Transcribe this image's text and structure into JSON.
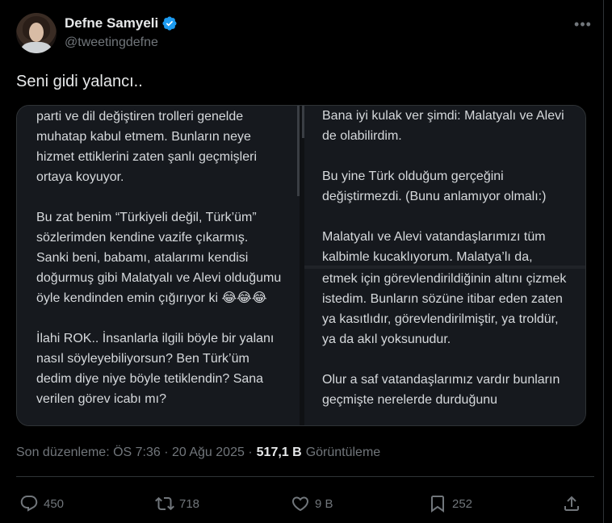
{
  "author": {
    "display_name": "Defne Samyeli",
    "handle": "@tweetingdefne"
  },
  "tweet": {
    "text": "Seni gidi yalancı..",
    "media": {
      "left_text": "parti ve dil değiştiren trolleri genelde muhatap kabul etmem. Bunların neye hizmet ettiklerini zaten şanlı geçmişleri ortaya koyuyor.\n\nBu zat benim “Türkiyeli değil, Türk’üm” sözlerimden kendine vazife çıkarmış. Sanki beni, babamı, atalarımı kendisi doğurmuş gibi  Malatyalı ve Alevi olduğumu öyle kendinden emin çığırıyor ki 😂😂😂\n\n İlahi ROK.. İnsanlarla ilgili böyle bir yalanı nasıl söyleyebiliyorsun? Ben Türk’üm dedim diye niye böyle tetiklendin? Sana verilen görev icabı mı?",
      "right_top_text": "Bana iyi kulak ver şimdi: Malatyalı ve Alevi de olabilirdim.\n\nBu yine Türk olduğum gerçeğini değiştirmezdi. (Bunu anlamıyor olmalı:)\n\nMalatyalı ve Alevi vatandaşlarımızı tüm kalbimle kucaklıyorum. Malatya’lı da,",
      "right_bottom_text": "etmek için görevlendirildiğinin altını çizmek istedim. Bunların sözüne itibar eden zaten ya kasıtlıdır, görevlendirilmiştir, ya troldür, ya da akıl yoksunudur.\n\nOlur a saf vatandaşlarımız vardır bunların geçmişte nerelerde durduğunu"
    },
    "meta": {
      "edited": "Son düzenleme: ÖS 7:36 · 20 Ağu 2025 ·",
      "views_count": "517,1 B",
      "views_label": "Görüntüleme"
    },
    "actions": {
      "replies": "450",
      "reposts": "718",
      "likes": "9 B",
      "bookmarks": "252"
    }
  },
  "colors": {
    "background": "#000000",
    "text": "#e7e9ea",
    "secondary": "#71767b",
    "verified": "#1d9bf0",
    "border": "#2f3336"
  }
}
